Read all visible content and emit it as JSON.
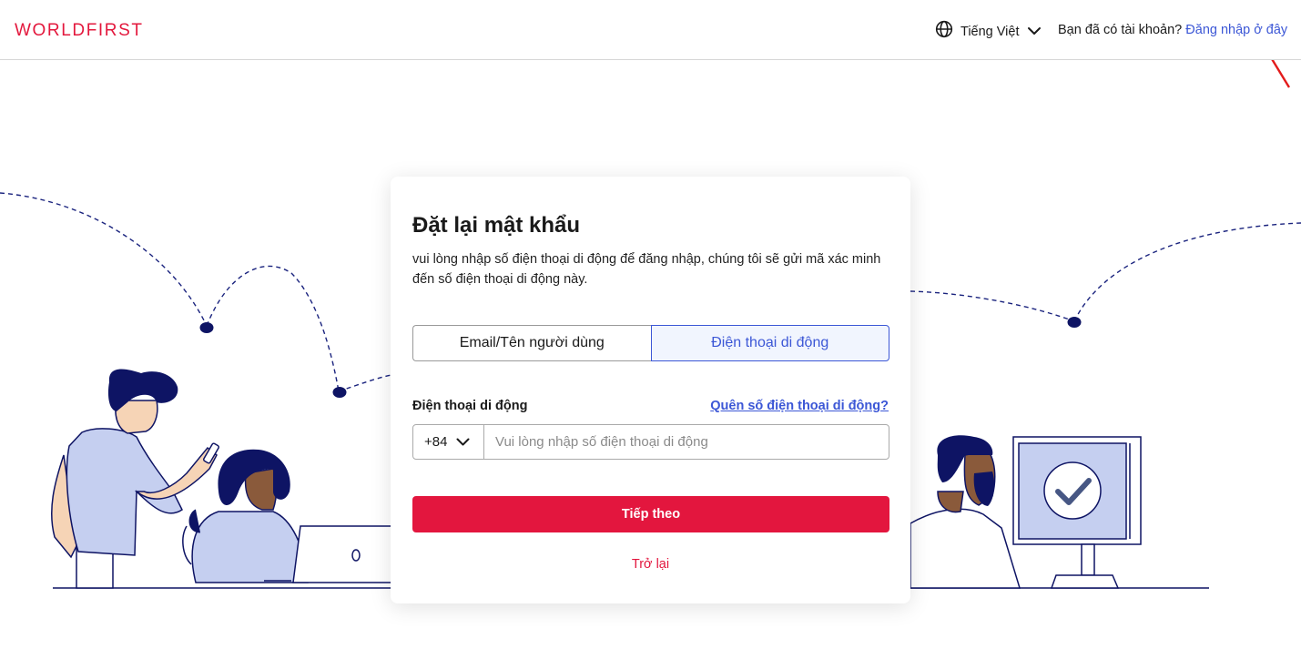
{
  "header": {
    "logo": "WORLDFIRST",
    "language": "Tiếng Việt",
    "account_prompt": "Bạn đã có tài khoản?",
    "login_link": "Đăng nhập ở đây"
  },
  "card": {
    "title": "Đặt lại mật khẩu",
    "description": "vui lòng nhập số điện thoại di động để đăng nhập, chúng tôi sẽ gửi mã xác minh đến số điện thoại di động này.",
    "tabs": [
      {
        "label": "Email/Tên người dùng",
        "active": false
      },
      {
        "label": "Điện thoại di động",
        "active": true
      }
    ],
    "phone_label": "Điện thoại di động",
    "forgot_link": "Quên số điện thoại di động?",
    "country_code": "+84",
    "phone_placeholder": "Vui lòng nhập số điện thoại di động",
    "phone_value": "",
    "next_button": "Tiếp theo",
    "back_link": "Trở lại"
  },
  "colors": {
    "brand_red": "#e3183d",
    "link_blue": "#3c57d6",
    "navy": "#0e1464",
    "illustration_lilac": "#c5cff0"
  },
  "icons": {
    "language": "globe-icon",
    "dropdown": "chevron-down-icon",
    "annotation": "red-arrow-icon",
    "checkmark": "check-icon"
  }
}
